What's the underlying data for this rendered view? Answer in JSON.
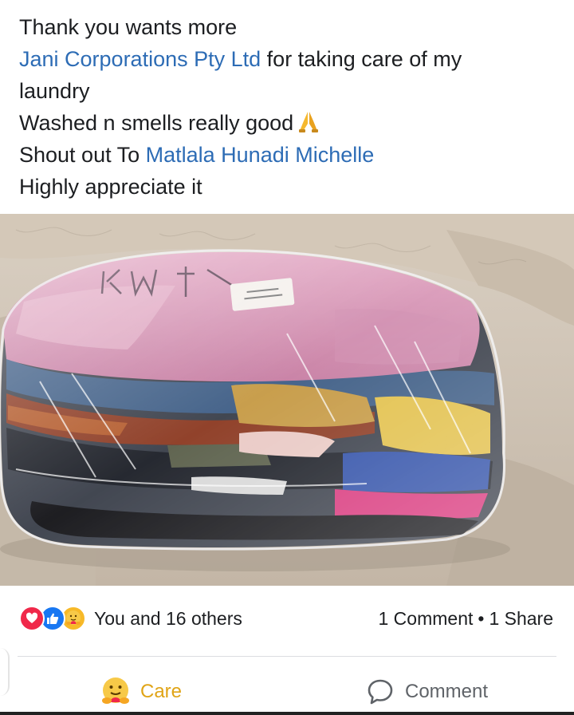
{
  "post": {
    "line1": "Thank you wants more",
    "mention_company": "Jani Corporations Pty Ltd",
    "line2_rest": " for taking care of my",
    "line3": "laundry",
    "line4": "Washed n smells really good",
    "line5_prefix": "Shout out To ",
    "mention_person": "Matlala Hunadi Michelle",
    "line6": "Highly appreciate it"
  },
  "photo": {
    "icon": "laundry-bag-photo"
  },
  "stats": {
    "reactions": [
      "love",
      "like",
      "care"
    ],
    "reaction_text": "You and 16 others",
    "comments": "1 Comment",
    "separator": "•",
    "shares": "1 Share"
  },
  "actions": {
    "care_label": "Care",
    "comment_label": "Comment"
  },
  "colors": {
    "mention": "#2d6cb5",
    "love": "#f0284a",
    "like": "#1877f2",
    "care": "#f7b928",
    "care_label": "#e0a416"
  }
}
